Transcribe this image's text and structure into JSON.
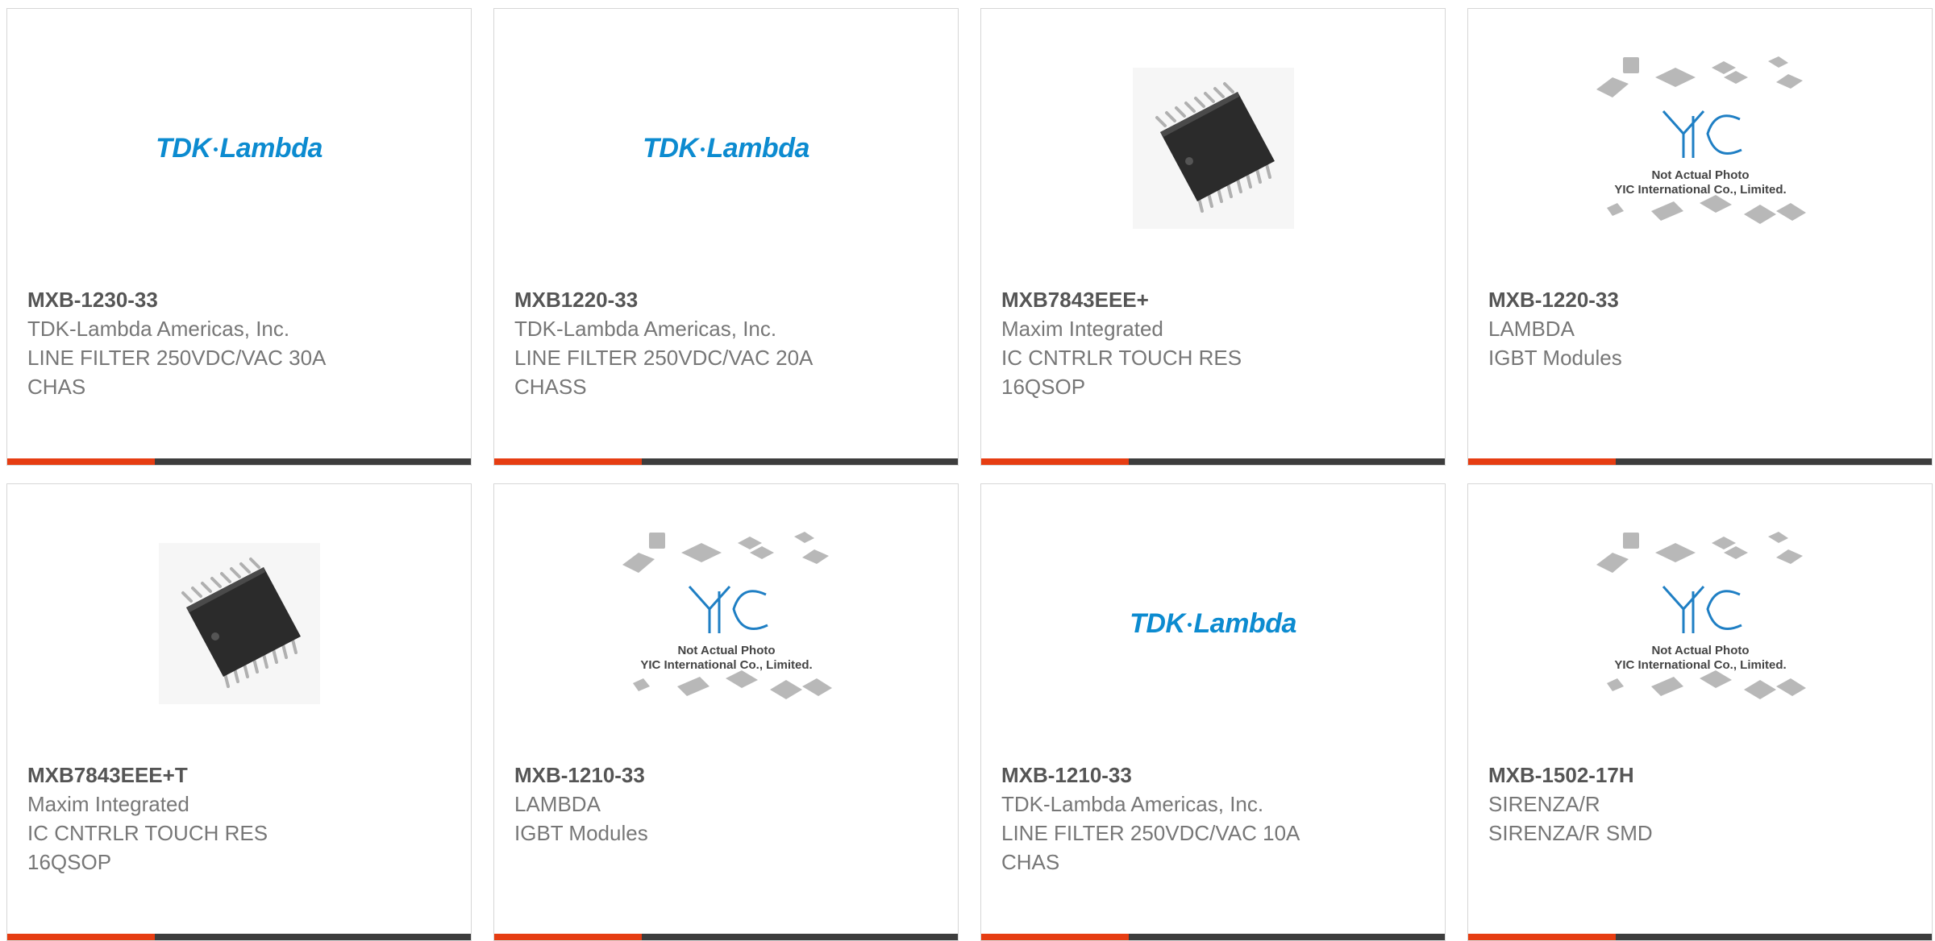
{
  "products": [
    {
      "part": "MXB-1230-33",
      "manufacturer": "TDK-Lambda Americas, Inc.",
      "desc1": "LINE FILTER 250VDC/VAC 30A",
      "desc2": "CHAS",
      "image": "tdk-lambda-logo",
      "logo_text": "TDK",
      "logo_text2": "Lambda"
    },
    {
      "part": "MXB1220-33",
      "manufacturer": "TDK-Lambda Americas, Inc.",
      "desc1": "LINE FILTER 250VDC/VAC 20A",
      "desc2": "CHASS",
      "image": "tdk-lambda-logo",
      "logo_text": "TDK",
      "logo_text2": "Lambda"
    },
    {
      "part": "MXB7843EEE+",
      "manufacturer": "Maxim Integrated",
      "desc1": "IC CNTRLR TOUCH RES",
      "desc2": "16QSOP",
      "image": "ic-chip-photo"
    },
    {
      "part": "MXB-1220-33",
      "manufacturer": "LAMBDA",
      "desc1": "IGBT Modules",
      "desc2": "",
      "image": "yic-placeholder",
      "placeholder_line1": "Not Actual Photo",
      "placeholder_line2": "YIC International Co., Limited."
    },
    {
      "part": "MXB7843EEE+T",
      "manufacturer": "Maxim Integrated",
      "desc1": "IC CNTRLR TOUCH RES",
      "desc2": "16QSOP",
      "image": "ic-chip-photo"
    },
    {
      "part": "MXB-1210-33",
      "manufacturer": "LAMBDA",
      "desc1": "IGBT Modules",
      "desc2": "",
      "image": "yic-placeholder",
      "placeholder_line1": "Not Actual Photo",
      "placeholder_line2": "YIC International Co., Limited."
    },
    {
      "part": "MXB-1210-33",
      "manufacturer": "TDK-Lambda Americas, Inc.",
      "desc1": "LINE FILTER 250VDC/VAC 10A",
      "desc2": "CHAS",
      "image": "tdk-lambda-logo",
      "logo_text": "TDK",
      "logo_text2": "Lambda"
    },
    {
      "part": "MXB-1502-17H",
      "manufacturer": "SIRENZA/R",
      "desc1": "SIRENZA/R SMD",
      "desc2": "",
      "image": "yic-placeholder",
      "placeholder_line1": "Not Actual Photo",
      "placeholder_line2": "YIC International Co., Limited."
    }
  ],
  "colors": {
    "accent": "#e63d12",
    "bar": "#3d3d3d",
    "logo_blue": "#0c8bd0",
    "yic_blue": "#1f7fc4"
  }
}
